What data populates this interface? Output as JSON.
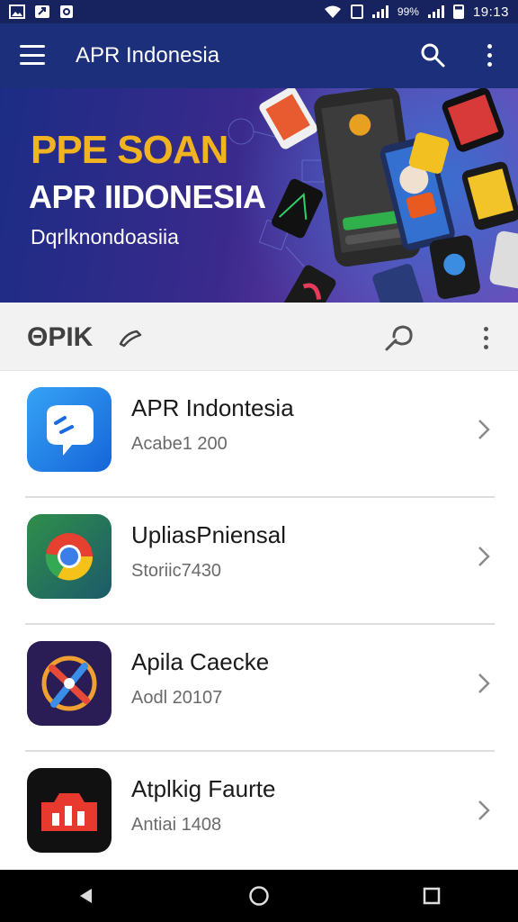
{
  "status_bar": {
    "time": "19:13",
    "battery_text": "99%",
    "left_icons": [
      "image-icon",
      "send-icon",
      "lock-icon"
    ],
    "right_icons": [
      "wifi-icon",
      "cast-icon",
      "signal-icon",
      "battery-icon"
    ]
  },
  "app_bar": {
    "title": "APR Indonesia",
    "background": "#1b2f7a"
  },
  "banner": {
    "line1": "PPE SOAN",
    "line2": "APR IIDONESIA",
    "line3": "Dqrlknondoasiia",
    "colors": {
      "headline": "#f2b320",
      "text": "#ffffff"
    }
  },
  "section": {
    "title": "ΘPIK"
  },
  "apps": [
    {
      "name": "APR Indontesia",
      "subtitle": "Acabe1 200",
      "icon": "chat-bubble-icon"
    },
    {
      "name": "UpliasPniensal",
      "subtitle": "Storiic7430",
      "icon": "chrome-like-icon"
    },
    {
      "name": "Apila Caecke",
      "subtitle": "Aodl 20107",
      "icon": "cross-circle-icon"
    },
    {
      "name": "Atplkig Faurte",
      "subtitle": "Antiai 1408",
      "icon": "bar-chart-icon"
    }
  ],
  "nav_bar": {
    "buttons": [
      "back-icon",
      "home-icon",
      "recents-icon"
    ]
  }
}
